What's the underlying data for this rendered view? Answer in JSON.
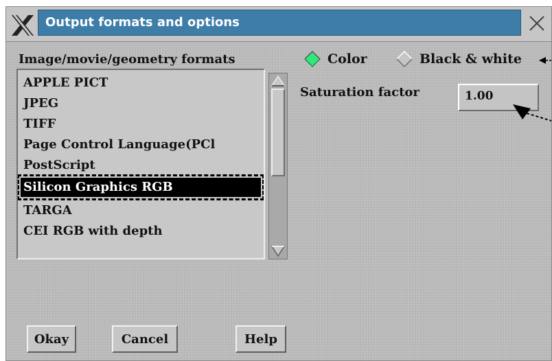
{
  "window": {
    "title": "Output formats and options"
  },
  "formats": {
    "label": "Image/movie/geometry formats",
    "items": [
      "APPLE PICT",
      "JPEG",
      "TIFF",
      "Page Control Language(PCl",
      "PostScript",
      "Silicon Graphics RGB",
      "TARGA",
      "CEI RGB with depth"
    ],
    "selected": "Silicon Graphics RGB"
  },
  "color_mode": {
    "options": [
      "Color",
      "Black & white"
    ],
    "selected": "Color"
  },
  "saturation": {
    "label": "Saturation factor",
    "value": "1.00"
  },
  "buttons": {
    "okay": "Okay",
    "cancel": "Cancel",
    "help": "Help"
  },
  "colors": {
    "title_bg": "#3d7da8",
    "panel_bg": "#b8b8b8",
    "radio_selected": "#2ee87a",
    "selection_bg": "#000000"
  },
  "icons": [
    "x-window-icon",
    "close-icon",
    "scroll-up-arrow-icon",
    "scroll-down-arrow-icon",
    "radio-diamond-icon"
  ]
}
